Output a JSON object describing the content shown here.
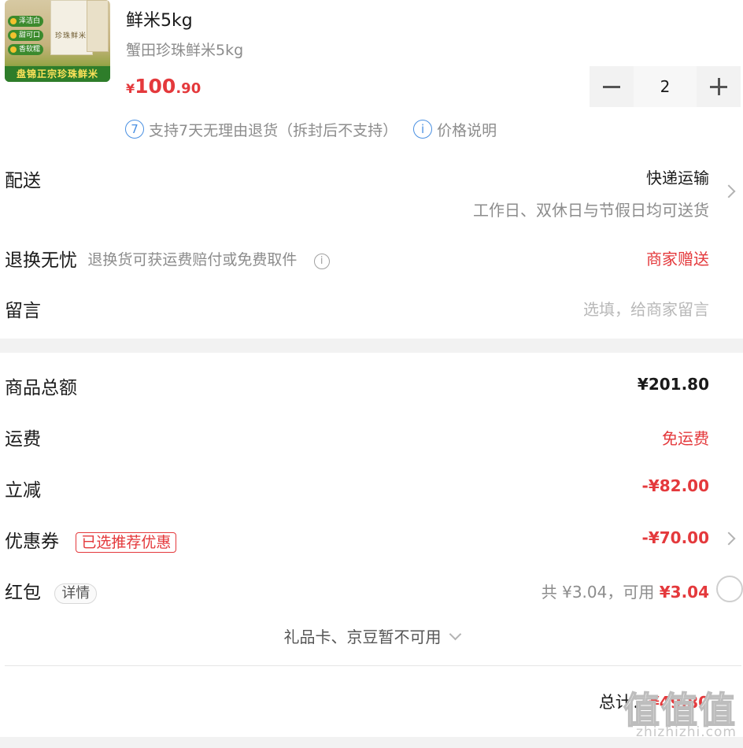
{
  "product": {
    "image_band_text": "盘锦正宗珍珠鲜米",
    "image_tags": [
      "泽洁白",
      "甜可口",
      "香软糯"
    ],
    "image_bag_text": "珍珠鲜米",
    "title": "鲜米5kg",
    "subtitle": "蟹田珍珠鲜米5kg",
    "price_currency": "¥",
    "price_int": "100",
    "price_dec": ".90",
    "quantity": "2"
  },
  "policy": {
    "return_icon": "7",
    "return_text": "支持7天无理由退货（拆封后不支持）",
    "info_icon": "i",
    "price_text": "价格说明"
  },
  "delivery": {
    "label": "配送",
    "method": "快递运输",
    "note": "工作日、双休日与节假日均可送货"
  },
  "returns": {
    "label": "退换无忧",
    "desc": "退换货可获运费赔付或免费取件",
    "info_icon": "i",
    "value": "商家赠送"
  },
  "message": {
    "label": "留言",
    "placeholder": "选填，给商家留言"
  },
  "summary": {
    "goods_total_label": "商品总额",
    "goods_total_value": "¥201.80",
    "shipping_label": "运费",
    "shipping_value": "免运费",
    "discount_label": "立减",
    "discount_value": "-¥82.00",
    "coupon_label": "优惠券",
    "coupon_badge": "已选推荐优惠",
    "coupon_value": "-¥70.00",
    "redpacket_label": "红包",
    "redpacket_detail": "详情",
    "redpacket_total": "共 ¥3.04，可用 ",
    "redpacket_available": "¥3.04",
    "giftcard_text": "礼品卡、京豆暂不可用",
    "total_label": "总计：",
    "total_value": "¥49.80"
  },
  "watermark": {
    "text": "值值值",
    "url": "zhizhizhi.com"
  },
  "colors": {
    "accent_red": "#e4393c",
    "info_blue": "#4a90e2",
    "muted_gray": "#8c8c8c",
    "band_gray": "#f2f2f2"
  }
}
